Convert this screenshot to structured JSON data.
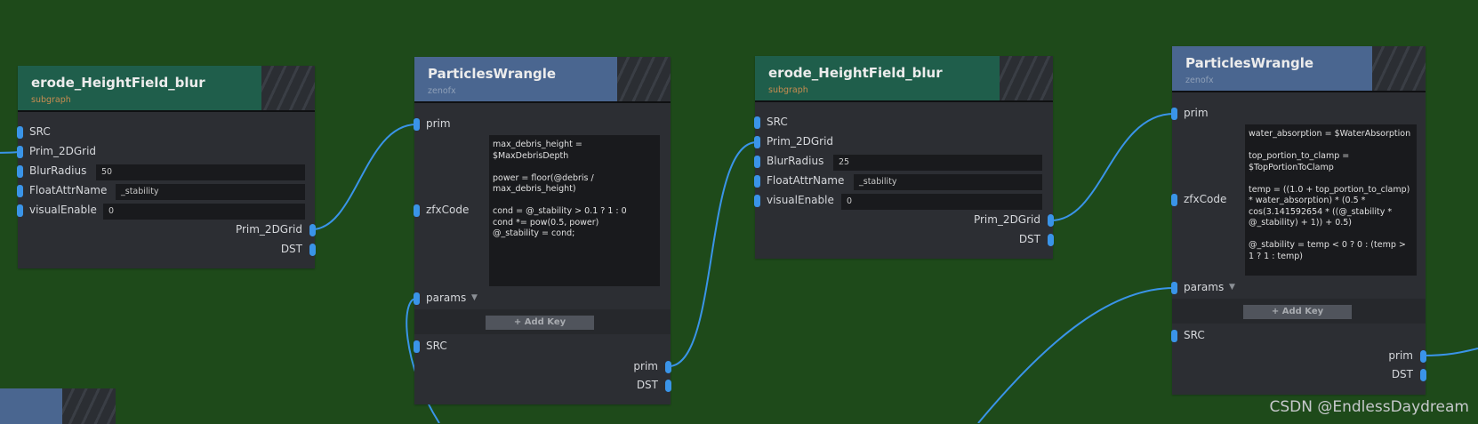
{
  "nodes": [
    {
      "title": "erode_HeightField_blur",
      "subtitle": "subgraph",
      "inputs": [
        "SRC",
        "Prim_2DGrid",
        "BlurRadius",
        "FloatAttrName",
        "visualEnable"
      ],
      "values": {
        "BlurRadius": "50",
        "FloatAttrName": "_stability",
        "visualEnable": "0"
      },
      "outputs": [
        "Prim_2DGrid",
        "DST"
      ]
    },
    {
      "title": "ParticlesWrangle",
      "subtitle": "zenofx",
      "inputs": [
        "prim",
        "zfxCode",
        "params",
        "SRC"
      ],
      "code": "max_debris_height = $MaxDebrisDepth\n\npower = floor(@debris / max_debris_height)\n\ncond = @_stability > 0.1 ? 1 : 0\ncond *= pow(0.5, power)\n@_stability = cond;",
      "add_key": "+ Add Key",
      "outputs": [
        "prim",
        "DST"
      ]
    },
    {
      "title": "erode_HeightField_blur",
      "subtitle": "subgraph",
      "inputs": [
        "SRC",
        "Prim_2DGrid",
        "BlurRadius",
        "FloatAttrName",
        "visualEnable"
      ],
      "values": {
        "BlurRadius": "25",
        "FloatAttrName": "_stability",
        "visualEnable": "0"
      },
      "outputs": [
        "Prim_2DGrid",
        "DST"
      ]
    },
    {
      "title": "ParticlesWrangle",
      "subtitle": "zenofx",
      "inputs": [
        "prim",
        "zfxCode",
        "params",
        "SRC"
      ],
      "code": "water_absorption = $WaterAbsorption\n\ntop_portion_to_clamp = $TopPortionToClamp\n\ntemp = ((1.0 + top_portion_to_clamp) * water_absorption) * (0.5 * cos(3.141592654 * ((@_stability * @_stability) + 1)) + 0.5)\n\n@_stability = temp < 0 ? 0 : (temp > 1 ? 1 : temp)",
      "add_key": "+ Add Key",
      "outputs": [
        "prim",
        "DST"
      ]
    }
  ],
  "watermark": "CSDN @EndlessDaydream",
  "colors": {
    "canvas_background": "#1e4a1a",
    "subgraph_header": "#1f5e4b",
    "zenofx_header": "#4a6690",
    "node_body": "#2c2e33",
    "socket": "#3a94e8",
    "wire": "#3a94e8"
  }
}
